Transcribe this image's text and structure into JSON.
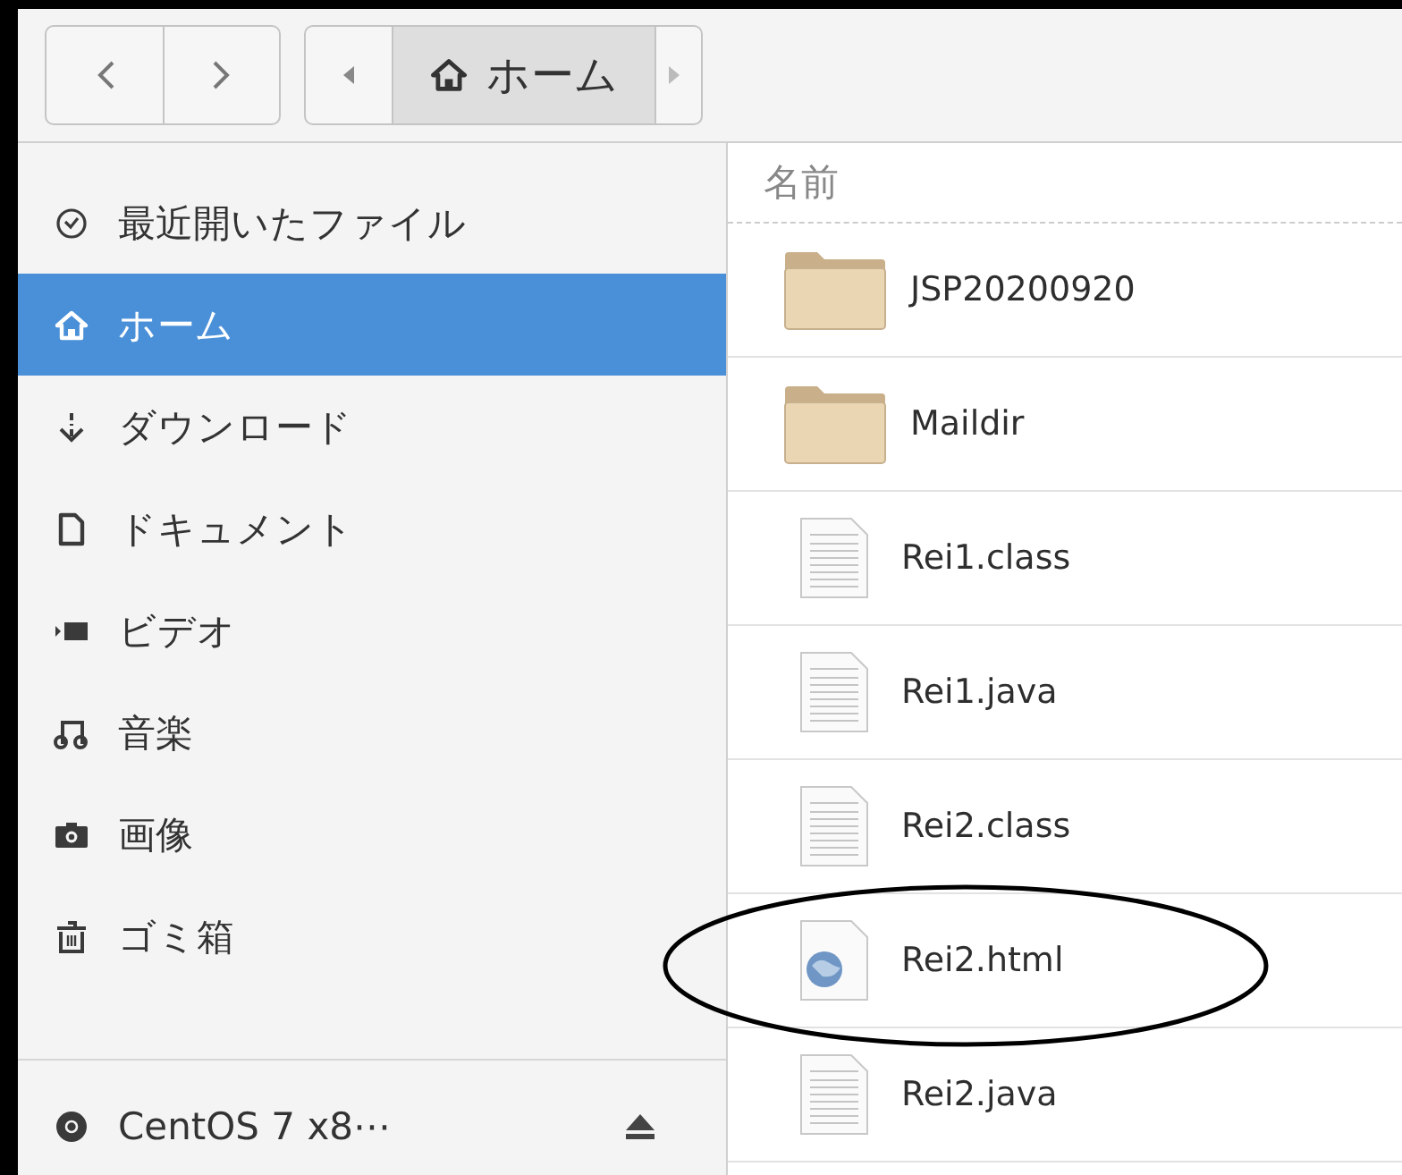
{
  "toolbar": {
    "path": [
      {
        "label": "ホーム",
        "selected": true
      }
    ]
  },
  "sidebar": {
    "places": [
      {
        "label": "最近開いたファイル",
        "kind": "recent",
        "selected": false
      },
      {
        "label": "ホーム",
        "kind": "home",
        "selected": true
      },
      {
        "label": "ダウンロード",
        "kind": "downloads",
        "selected": false
      },
      {
        "label": "ドキュメント",
        "kind": "documents",
        "selected": false
      },
      {
        "label": "ビデオ",
        "kind": "videos",
        "selected": false
      },
      {
        "label": "音楽",
        "kind": "music",
        "selected": false
      },
      {
        "label": "画像",
        "kind": "pictures",
        "selected": false
      },
      {
        "label": "ゴミ箱",
        "kind": "trash",
        "selected": false
      }
    ],
    "devices": [
      {
        "label": "CentOS 7 x8⋯",
        "kind": "disc",
        "selected": false
      }
    ]
  },
  "file_list": {
    "columns": [
      "名前"
    ],
    "files": [
      {
        "name": "JSP20200920",
        "kind": "folder",
        "circled": false
      },
      {
        "name": "Maildir",
        "kind": "folder",
        "circled": false
      },
      {
        "name": "Rei1.class",
        "kind": "text",
        "circled": false
      },
      {
        "name": "Rei1.java",
        "kind": "text",
        "circled": false
      },
      {
        "name": "Rei2.class",
        "kind": "text",
        "circled": false
      },
      {
        "name": "Rei2.html",
        "kind": "html",
        "circled": true
      },
      {
        "name": "Rei2.java",
        "kind": "text",
        "circled": false
      }
    ]
  }
}
